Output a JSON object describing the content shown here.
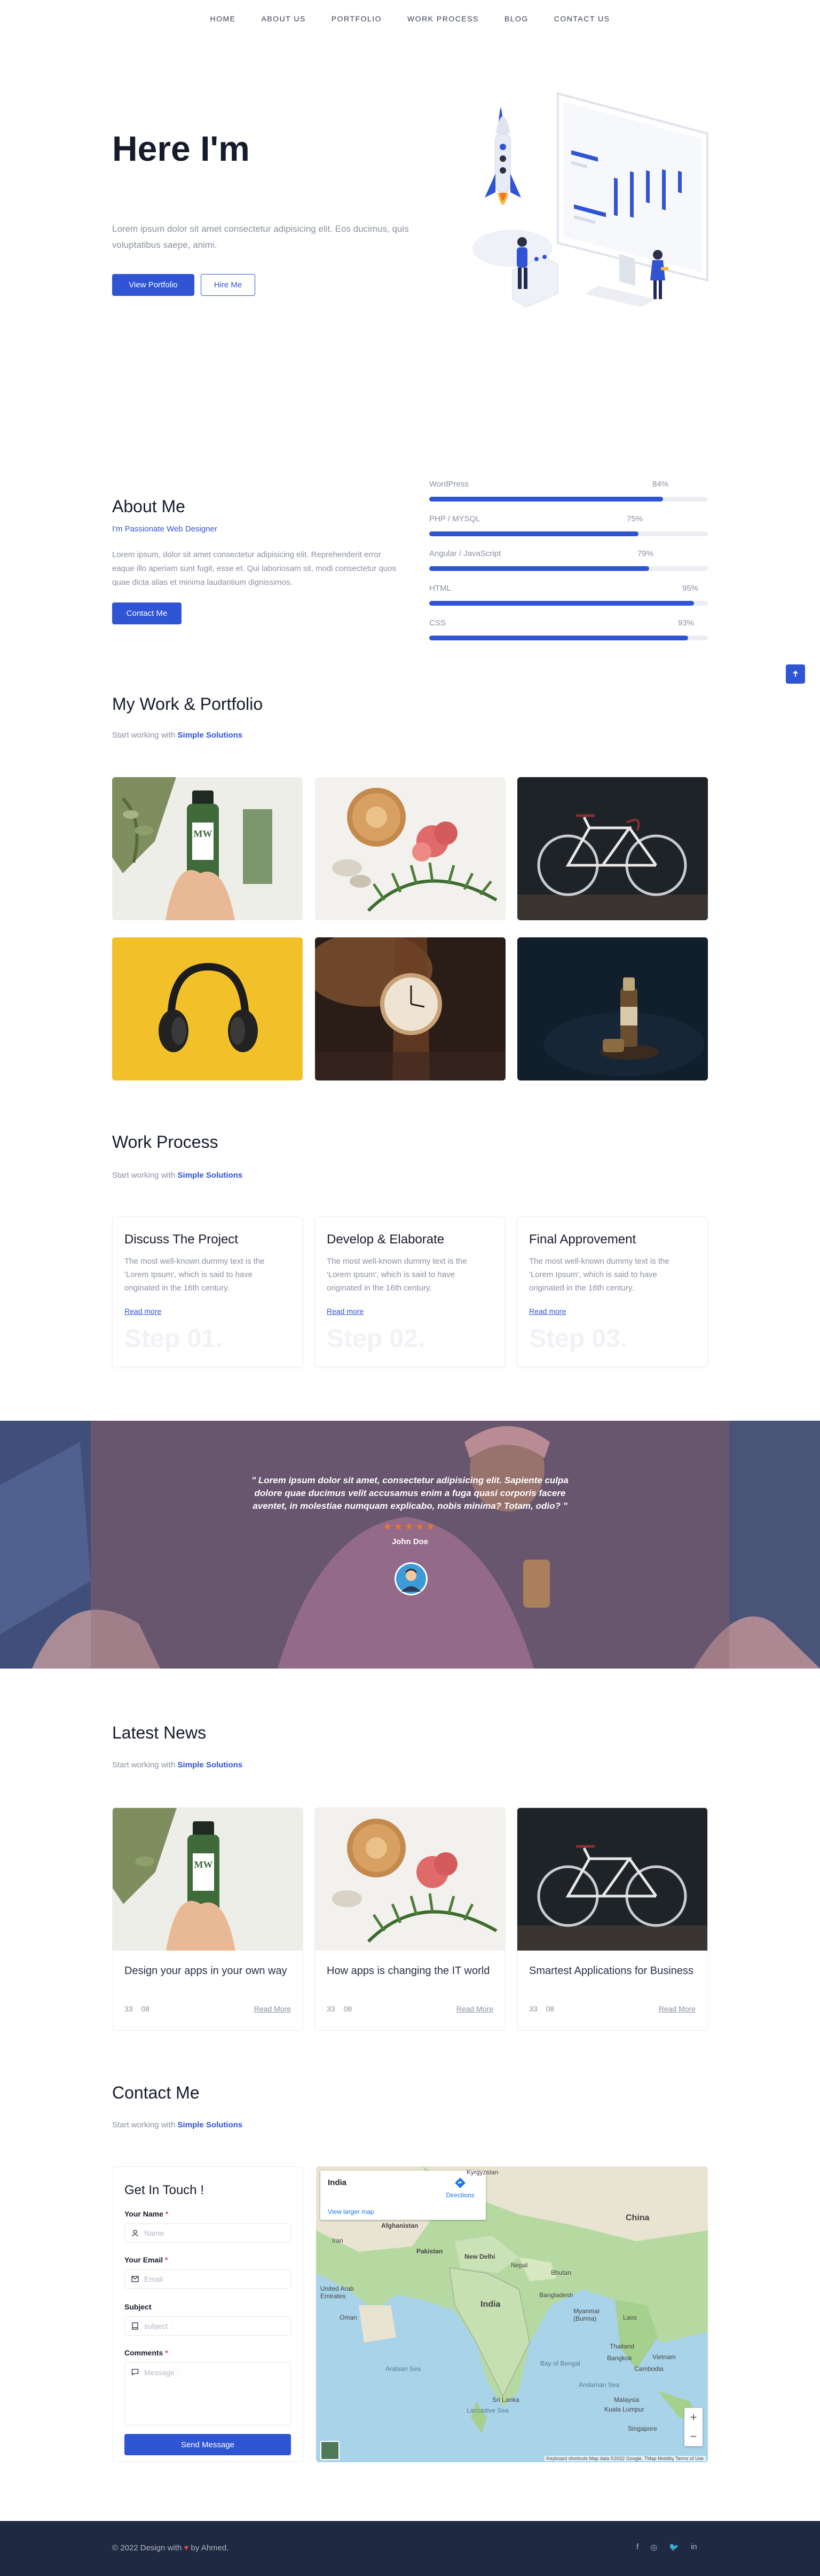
{
  "nav": {
    "items": [
      {
        "label": "HOME"
      },
      {
        "label": "ABOUT US"
      },
      {
        "label": "PORTFOLIO"
      },
      {
        "label": "WORK PROCESS"
      },
      {
        "label": "BLOG"
      },
      {
        "label": "CONTACT US"
      }
    ]
  },
  "hero": {
    "title": "Here I'm",
    "text": "Lorem ipsum dolor sit amet consectetur adipisicing elit. Eos ducimus, quis voluptatibus saepe, animi.",
    "primary_button": "View Portfolio",
    "secondary_button": "Hire Me"
  },
  "about": {
    "title": "About Me",
    "subtitle": "I'm Passionate Web Designer",
    "text": "Lorem ipsum, dolor sit amet consectetur adipisicing elit. Reprehenderit error eaque illo aperiam sunt fugit, esse et. Qui laboriosam sit, modi consectetur quos quae dicta alias et minima laudantium dignissimos.",
    "button": "Contact Me",
    "skills": [
      {
        "name": "WordPress",
        "value": "84%",
        "percent": 84
      },
      {
        "name": "PHP / MYSQL",
        "value": "75%",
        "percent": 75
      },
      {
        "name": "Angular / JavaScript",
        "value": "79%",
        "percent": 79
      },
      {
        "name": "HTML",
        "value": "95%",
        "percent": 95
      },
      {
        "name": "CSS",
        "value": "93%",
        "percent": 93
      }
    ]
  },
  "scroll_top_icon": "arrow-up-icon",
  "portfolio": {
    "title": "My Work & Portfolio",
    "subtitle_prefix": "Start working with ",
    "subtitle_highlight": "Simple Solutions",
    "images": [
      {
        "name": "green-bottle-photo"
      },
      {
        "name": "flowers-and-fern-photo"
      },
      {
        "name": "bicycle-photo"
      },
      {
        "name": "headphones-photo"
      },
      {
        "name": "wristwatch-photo"
      },
      {
        "name": "bottle-on-dark-photo"
      }
    ]
  },
  "process": {
    "title": "Work Process",
    "subtitle_prefix": "Start working with ",
    "subtitle_highlight": "Simple Solutions",
    "cards": [
      {
        "title": "Discuss The Project",
        "text": "The most well-known dummy text is the 'Lorem Ipsum', which is said to have originated in the 16th century.",
        "link": "Read more",
        "step": "Step 01."
      },
      {
        "title": "Develop & Elaborate",
        "text": "The most well-known dummy text is the 'Lorem Ipsum', which is said to have originated in the 16th century.",
        "link": "Read more",
        "step": "Step 02."
      },
      {
        "title": "Final Approvement",
        "text": "The most well-known dummy text is the 'Lorem Ipsum', which is said to have originated in the 16th century.",
        "link": "Read more",
        "step": "Step 03."
      }
    ]
  },
  "testimonial": {
    "quote": "\" Lorem ipsum dolor sit amet, consectetur adipisicing elit. Sapiente culpa dolore quae ducimus velit accusamus enim a fuga quasi corporis facere aventet, in molestiae numquam explicabo, nobis minima? Totam, odio? \"",
    "stars": "★★★★★",
    "name": "John Doe"
  },
  "news": {
    "title": "Latest News",
    "subtitle_prefix": "Start working with ",
    "subtitle_highlight": "Simple Solutions",
    "cards": [
      {
        "title": "Design your apps in your own way",
        "likes": "33",
        "comments": "08",
        "read": "Read More"
      },
      {
        "title": "How apps is changing the IT world",
        "likes": "33",
        "comments": "08",
        "read": "Read More"
      },
      {
        "title": "Smartest Applications for Business",
        "likes": "33",
        "comments": "08",
        "read": "Read More"
      }
    ]
  },
  "contact": {
    "title": "Contact Me",
    "subtitle_prefix": "Start working with ",
    "subtitle_highlight": "Simple Solutions",
    "form_title": "Get In Touch !",
    "name_label": "Your Name",
    "name_placeholder": "Name",
    "email_label": "Your Email",
    "email_placeholder": "Email",
    "subject_label": "Subject",
    "subject_placeholder": "subject :",
    "comments_label": "Comments",
    "comments_placeholder": "Message :",
    "required_mark": "*",
    "send_button": "Send Message"
  },
  "map": {
    "place_name": "India",
    "directions": "Directions",
    "view_larger": "View larger map",
    "labels": [
      "Kyrgyzstan",
      "Afghanistan",
      "Pakistan",
      "New Delhi",
      "Nepal",
      "Bhutan",
      "China",
      "Iran",
      "United Arab Emirates",
      "Oman",
      "India",
      "Bangladesh",
      "Myanmar (Burma)",
      "Laos",
      "Thailand",
      "Bangkok",
      "Vietnam",
      "Cambodia",
      "Arabian Sea",
      "Bay of Bengal",
      "Sri Lanka",
      "Andaman Sea",
      "Malaysia",
      "Kuala Lumpur",
      "Singapore",
      "Laccadive Sea"
    ],
    "zoom_in": "+",
    "zoom_out": "−",
    "attribution": "Keyboard shortcuts   Map data ©2022 Google, TMap Mobility   Terms of Use"
  },
  "footer": {
    "copy_prefix": "© 2022 Design with ",
    "heart": "♥",
    "copy_suffix": " by Ahmed.",
    "social": [
      {
        "icon": "facebook-icon",
        "glyph": "f"
      },
      {
        "icon": "instagram-icon",
        "glyph": "◎"
      },
      {
        "icon": "twitter-icon",
        "glyph": "🐦"
      },
      {
        "icon": "linkedin-icon",
        "glyph": "in"
      }
    ]
  },
  "colors": {
    "primary": "#2f55d4",
    "text_muted": "#8a90a2",
    "footer_bg": "#202942",
    "star": "#f17425"
  }
}
